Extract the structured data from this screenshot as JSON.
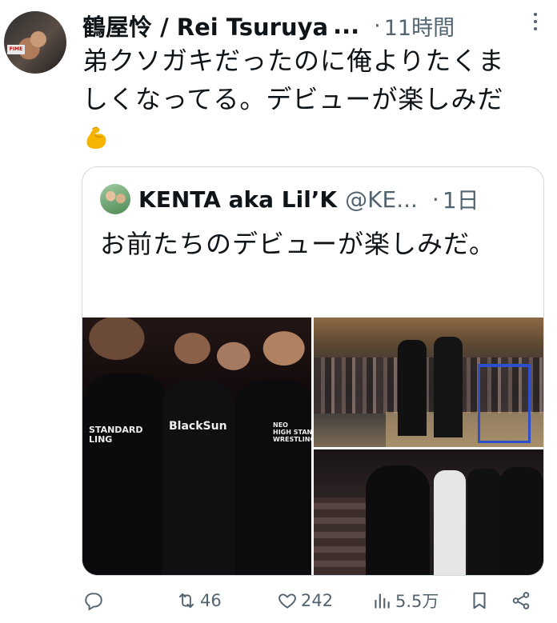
{
  "tweet": {
    "display_name": "鶴屋怜 / Rei Tsuruya",
    "handle_truncated": "...",
    "separator": "·",
    "time": "11時間",
    "text": "弟クソガキだったのに俺よりたくましくなってる。デビューが楽しみだ"
  },
  "quote": {
    "display_name": "KENTA aka Lil’K",
    "handle": "@KE...",
    "separator": "·",
    "time": "1日",
    "text": "お前たちのデビューが楽しみだ。",
    "photo_text": {
      "shirt_left": "STANDARD\nLING",
      "shirt_center": "BlackSun",
      "shirt_right": "NEO\nHIGH STANDARD\nWRESTLING"
    }
  },
  "actions": {
    "reply_count": "",
    "retweet_count": "46",
    "like_count": "242",
    "views_count": "5.5万"
  },
  "icons": {
    "more": "more-vertical-icon",
    "emoji": "flexed-biceps-emoji",
    "reply": "reply-icon",
    "retweet": "retweet-icon",
    "like": "heart-icon",
    "views": "views-icon",
    "bookmark": "bookmark-icon",
    "share": "share-icon"
  },
  "colors": {
    "text": "#0f1419",
    "secondary": "#536471",
    "border": "#cfd9de"
  }
}
